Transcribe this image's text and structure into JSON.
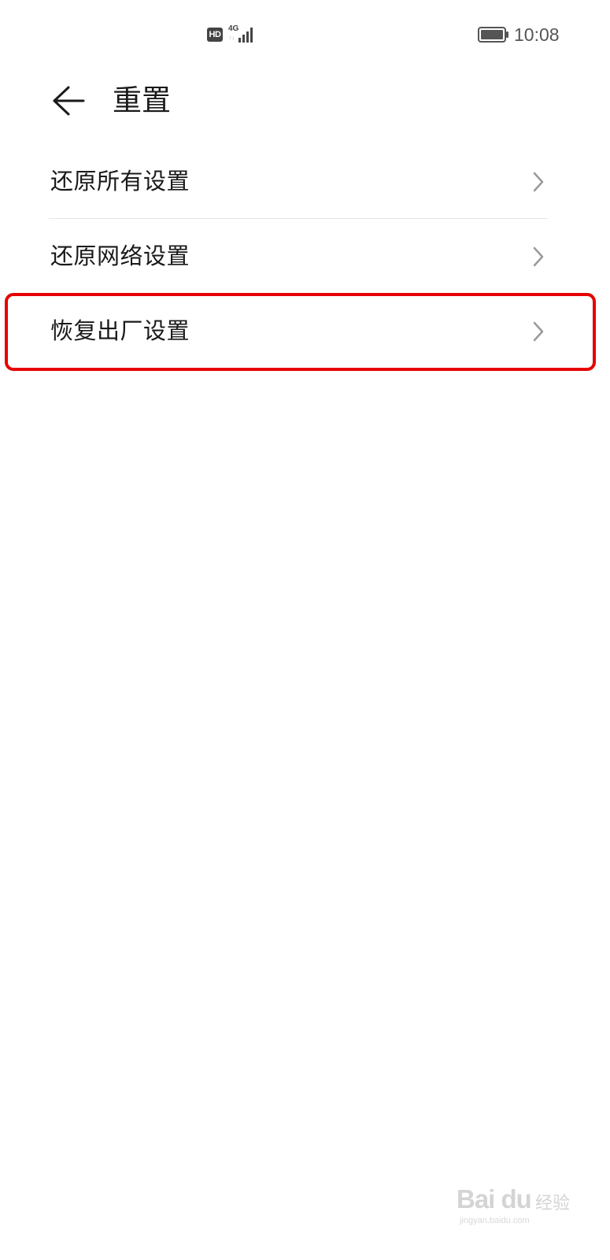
{
  "status_bar": {
    "hd_label": "HD",
    "network_type": "4G",
    "network_arrows": "↑↓",
    "signal_icon": "signal-bars-icon",
    "battery_icon": "battery-icon",
    "time": "10:08"
  },
  "header": {
    "back_icon": "arrow-left-icon",
    "title": "重置"
  },
  "list": {
    "items": [
      {
        "label": "还原所有设置",
        "icon": "chevron-right-icon"
      },
      {
        "label": "还原网络设置",
        "icon": "chevron-right-icon"
      },
      {
        "label": "恢复出厂设置",
        "icon": "chevron-right-icon",
        "highlighted": true
      }
    ]
  },
  "watermark": {
    "logo": "Bai du",
    "jingyan": "经验",
    "url": "jingyan.baidu.com"
  },
  "colors": {
    "highlight": "#e60000",
    "text_primary": "#1a1a1a",
    "chevron": "#999999",
    "divider": "#e6e6e6"
  }
}
